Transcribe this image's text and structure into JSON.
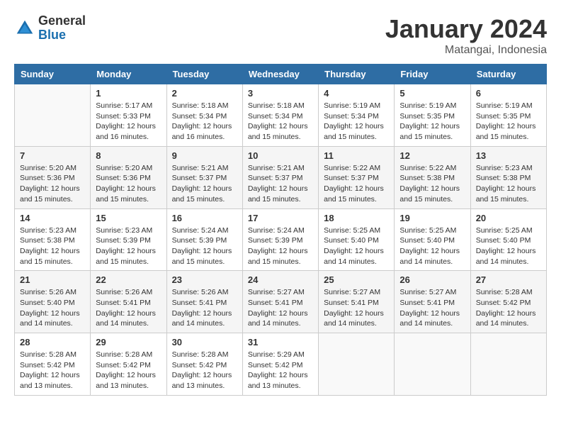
{
  "header": {
    "logo_general": "General",
    "logo_blue": "Blue",
    "month_title": "January 2024",
    "location": "Matangai, Indonesia"
  },
  "columns": [
    "Sunday",
    "Monday",
    "Tuesday",
    "Wednesday",
    "Thursday",
    "Friday",
    "Saturday"
  ],
  "weeks": [
    [
      {
        "day": "",
        "info": ""
      },
      {
        "day": "1",
        "info": "Sunrise: 5:17 AM\nSunset: 5:33 PM\nDaylight: 12 hours\nand 16 minutes."
      },
      {
        "day": "2",
        "info": "Sunrise: 5:18 AM\nSunset: 5:34 PM\nDaylight: 12 hours\nand 16 minutes."
      },
      {
        "day": "3",
        "info": "Sunrise: 5:18 AM\nSunset: 5:34 PM\nDaylight: 12 hours\nand 15 minutes."
      },
      {
        "day": "4",
        "info": "Sunrise: 5:19 AM\nSunset: 5:34 PM\nDaylight: 12 hours\nand 15 minutes."
      },
      {
        "day": "5",
        "info": "Sunrise: 5:19 AM\nSunset: 5:35 PM\nDaylight: 12 hours\nand 15 minutes."
      },
      {
        "day": "6",
        "info": "Sunrise: 5:19 AM\nSunset: 5:35 PM\nDaylight: 12 hours\nand 15 minutes."
      }
    ],
    [
      {
        "day": "7",
        "info": "Sunrise: 5:20 AM\nSunset: 5:36 PM\nDaylight: 12 hours\nand 15 minutes."
      },
      {
        "day": "8",
        "info": "Sunrise: 5:20 AM\nSunset: 5:36 PM\nDaylight: 12 hours\nand 15 minutes."
      },
      {
        "day": "9",
        "info": "Sunrise: 5:21 AM\nSunset: 5:37 PM\nDaylight: 12 hours\nand 15 minutes."
      },
      {
        "day": "10",
        "info": "Sunrise: 5:21 AM\nSunset: 5:37 PM\nDaylight: 12 hours\nand 15 minutes."
      },
      {
        "day": "11",
        "info": "Sunrise: 5:22 AM\nSunset: 5:37 PM\nDaylight: 12 hours\nand 15 minutes."
      },
      {
        "day": "12",
        "info": "Sunrise: 5:22 AM\nSunset: 5:38 PM\nDaylight: 12 hours\nand 15 minutes."
      },
      {
        "day": "13",
        "info": "Sunrise: 5:23 AM\nSunset: 5:38 PM\nDaylight: 12 hours\nand 15 minutes."
      }
    ],
    [
      {
        "day": "14",
        "info": "Sunrise: 5:23 AM\nSunset: 5:38 PM\nDaylight: 12 hours\nand 15 minutes."
      },
      {
        "day": "15",
        "info": "Sunrise: 5:23 AM\nSunset: 5:39 PM\nDaylight: 12 hours\nand 15 minutes."
      },
      {
        "day": "16",
        "info": "Sunrise: 5:24 AM\nSunset: 5:39 PM\nDaylight: 12 hours\nand 15 minutes."
      },
      {
        "day": "17",
        "info": "Sunrise: 5:24 AM\nSunset: 5:39 PM\nDaylight: 12 hours\nand 15 minutes."
      },
      {
        "day": "18",
        "info": "Sunrise: 5:25 AM\nSunset: 5:40 PM\nDaylight: 12 hours\nand 14 minutes."
      },
      {
        "day": "19",
        "info": "Sunrise: 5:25 AM\nSunset: 5:40 PM\nDaylight: 12 hours\nand 14 minutes."
      },
      {
        "day": "20",
        "info": "Sunrise: 5:25 AM\nSunset: 5:40 PM\nDaylight: 12 hours\nand 14 minutes."
      }
    ],
    [
      {
        "day": "21",
        "info": "Sunrise: 5:26 AM\nSunset: 5:40 PM\nDaylight: 12 hours\nand 14 minutes."
      },
      {
        "day": "22",
        "info": "Sunrise: 5:26 AM\nSunset: 5:41 PM\nDaylight: 12 hours\nand 14 minutes."
      },
      {
        "day": "23",
        "info": "Sunrise: 5:26 AM\nSunset: 5:41 PM\nDaylight: 12 hours\nand 14 minutes."
      },
      {
        "day": "24",
        "info": "Sunrise: 5:27 AM\nSunset: 5:41 PM\nDaylight: 12 hours\nand 14 minutes."
      },
      {
        "day": "25",
        "info": "Sunrise: 5:27 AM\nSunset: 5:41 PM\nDaylight: 12 hours\nand 14 minutes."
      },
      {
        "day": "26",
        "info": "Sunrise: 5:27 AM\nSunset: 5:41 PM\nDaylight: 12 hours\nand 14 minutes."
      },
      {
        "day": "27",
        "info": "Sunrise: 5:28 AM\nSunset: 5:42 PM\nDaylight: 12 hours\nand 14 minutes."
      }
    ],
    [
      {
        "day": "28",
        "info": "Sunrise: 5:28 AM\nSunset: 5:42 PM\nDaylight: 12 hours\nand 13 minutes."
      },
      {
        "day": "29",
        "info": "Sunrise: 5:28 AM\nSunset: 5:42 PM\nDaylight: 12 hours\nand 13 minutes."
      },
      {
        "day": "30",
        "info": "Sunrise: 5:28 AM\nSunset: 5:42 PM\nDaylight: 12 hours\nand 13 minutes."
      },
      {
        "day": "31",
        "info": "Sunrise: 5:29 AM\nSunset: 5:42 PM\nDaylight: 12 hours\nand 13 minutes."
      },
      {
        "day": "",
        "info": ""
      },
      {
        "day": "",
        "info": ""
      },
      {
        "day": "",
        "info": ""
      }
    ]
  ]
}
